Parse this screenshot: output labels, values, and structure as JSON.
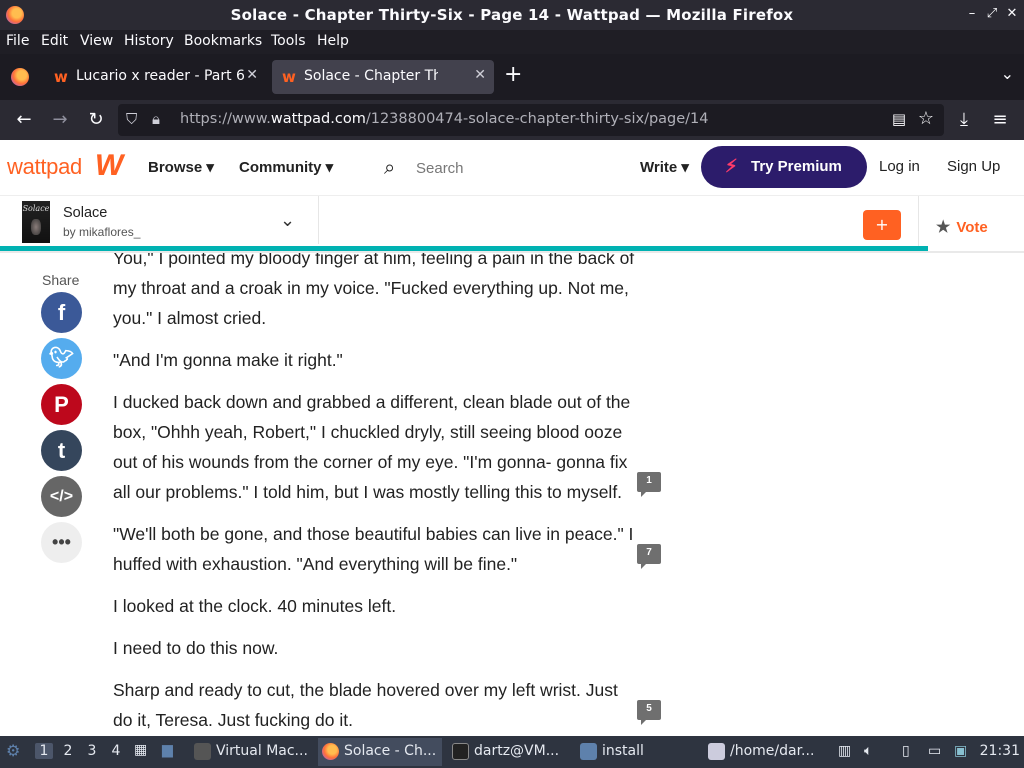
{
  "window": {
    "title": "Solace - Chapter Thirty-Six - Page 14 - Wattpad — Mozilla Firefox",
    "controls": [
      "–",
      "⤢",
      "✕"
    ]
  },
  "menu": [
    "File",
    "Edit",
    "View",
    "History",
    "Bookmarks",
    "Tools",
    "Help"
  ],
  "tabs": [
    {
      "label": "Lucario x reader - Part 6",
      "active": false
    },
    {
      "label": "Solace - Chapter Thirty-Six",
      "active": true
    }
  ],
  "address": {
    "prefix": "https://www.",
    "domain": "wattpad.com",
    "path": "/1238800474-solace-chapter-thirty-six/page/14"
  },
  "header": {
    "logo_text": "wattpad",
    "logo_mark": "W",
    "browse": "Browse ▾",
    "community": "Community ▾",
    "search_placeholder": "Search",
    "write": "Write ▾",
    "premium": "Try Premium",
    "login": "Log in",
    "signup": "Sign Up"
  },
  "story": {
    "cover_text": "Solace",
    "title": "Solace",
    "author": "by mikaflores_",
    "add": "+",
    "vote": "Vote",
    "progress_fraction": 0.906
  },
  "share": {
    "label": "Share"
  },
  "paragraphs": [
    {
      "text": "You,\" I pointed my bloody finger at him, feeling a pain in the back of my throat and a croak in my voice. \"Fucked everything up. Not me, you.\" I almost cried.",
      "comments": ""
    },
    {
      "text": "   \"And I'm gonna make it right.\"",
      "comments": ""
    },
    {
      "text": "   I ducked back down and grabbed a different, clean blade out of the box, \"Ohhh yeah, Robert,\" I chuckled dryly, still seeing blood ooze out of his wounds from the corner of my eye. \"I'm gonna- gonna fix all our problems.\" I told him, but I was mostly telling this to myself.",
      "comments": "1"
    },
    {
      "text": "   \"We'll both be gone, and those beautiful babies can live in peace.\" I huffed with exhaustion. \"And everything will be fine.\"",
      "comments": "7"
    },
    {
      "text": "I looked at the clock. 40 minutes left.",
      "comments": ""
    },
    {
      "text": "I need to do this now.",
      "comments": ""
    },
    {
      "text": "Sharp and ready to cut, the blade hovered over my left wrist. Just do it, Teresa. Just fucking do it.",
      "comments": "5"
    }
  ],
  "taskbar": {
    "workspaces": [
      "1",
      "2",
      "3",
      "4"
    ],
    "apps": [
      {
        "label": "Virtual Mac..."
      },
      {
        "label": "Solace - Ch..."
      },
      {
        "label": "dartz@VM..."
      },
      {
        "label": "install"
      },
      {
        "label": "/home/dar..."
      }
    ],
    "clock": "21:31"
  }
}
